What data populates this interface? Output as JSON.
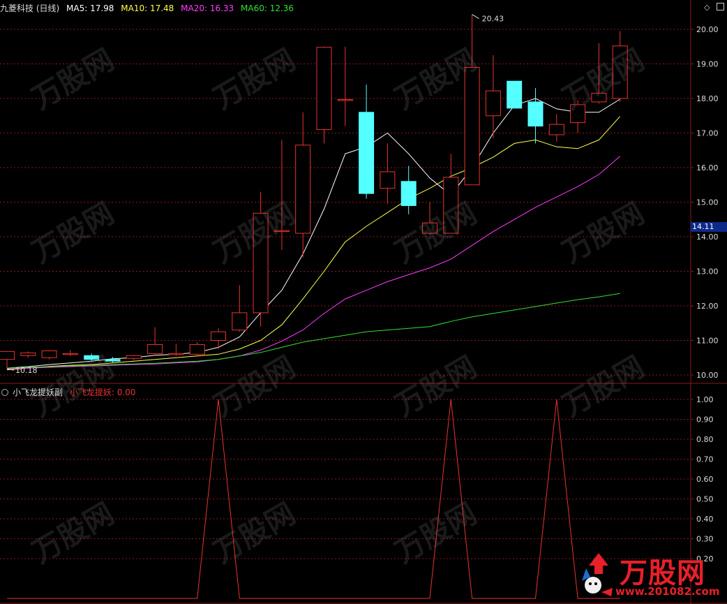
{
  "header": {
    "title": "九菱科技 (日线)",
    "ma5_label": "MA5: 17.98",
    "ma10_label": "MA10: 17.48",
    "ma20_label": "MA20: 16.33",
    "ma60_label": "MA60: 12.36"
  },
  "sub_header": {
    "title": "小飞龙提妖副",
    "value_label": "小飞龙提妖: 0.00"
  },
  "current_price": "14.11",
  "high_marker": "20.43",
  "low_marker": "10.18",
  "logo": {
    "brand": "万股网",
    "url": "www.201082.com"
  },
  "watermark": "万股网",
  "colors": {
    "background": "#000000",
    "up": "#e8342f",
    "down": "#54ffff",
    "ma5": "#ffffff",
    "ma10": "#ffff4d",
    "ma20": "#ff3cff",
    "ma60": "#33e033",
    "grid": "#8b1a1a",
    "axis_text": "#dddddd"
  },
  "chart_data": [
    {
      "type": "candlestick",
      "title": "",
      "ylim": [
        9.9,
        20.5
      ],
      "y_ticks": [
        "10.00",
        "11.00",
        "12.00",
        "13.00",
        "14.00",
        "15.00",
        "16.00",
        "17.00",
        "18.00",
        "19.00",
        "20.00"
      ],
      "y_tick_values": [
        10,
        11,
        12,
        13,
        14,
        15,
        16,
        17,
        18,
        19,
        20
      ],
      "grid": true,
      "candles": [
        {
          "o": 10.45,
          "h": 10.68,
          "l": 10.18,
          "c": 10.68
        },
        {
          "o": 10.56,
          "h": 10.68,
          "l": 10.5,
          "c": 10.64
        },
        {
          "o": 10.5,
          "h": 10.72,
          "l": 10.45,
          "c": 10.7
        },
        {
          "o": 10.6,
          "h": 10.72,
          "l": 10.55,
          "c": 10.62
        },
        {
          "o": 10.56,
          "h": 10.62,
          "l": 10.4,
          "c": 10.45
        },
        {
          "o": 10.45,
          "h": 10.52,
          "l": 10.35,
          "c": 10.4
        },
        {
          "o": 10.48,
          "h": 10.58,
          "l": 10.42,
          "c": 10.56
        },
        {
          "o": 10.62,
          "h": 11.38,
          "l": 10.55,
          "c": 10.88
        },
        {
          "o": 10.6,
          "h": 10.9,
          "l": 10.55,
          "c": 10.62
        },
        {
          "o": 10.6,
          "h": 10.95,
          "l": 10.55,
          "c": 10.88
        },
        {
          "o": 11.0,
          "h": 11.35,
          "l": 10.75,
          "c": 11.25
        },
        {
          "o": 11.3,
          "h": 12.6,
          "l": 11.25,
          "c": 11.8
        },
        {
          "o": 11.8,
          "h": 15.3,
          "l": 11.4,
          "c": 14.68
        },
        {
          "o": 14.18,
          "h": 16.8,
          "l": 13.62,
          "c": 14.18
        },
        {
          "o": 14.1,
          "h": 17.6,
          "l": 13.4,
          "c": 16.65
        },
        {
          "o": 17.1,
          "h": 19.5,
          "l": 16.7,
          "c": 19.48
        },
        {
          "o": 17.97,
          "h": 19.5,
          "l": 17.2,
          "c": 17.97
        },
        {
          "o": 17.6,
          "h": 18.4,
          "l": 15.1,
          "c": 15.25
        },
        {
          "o": 15.4,
          "h": 16.7,
          "l": 14.95,
          "c": 15.88
        },
        {
          "o": 15.6,
          "h": 16.05,
          "l": 14.65,
          "c": 14.9
        },
        {
          "o": 14.1,
          "h": 15.0,
          "l": 14.05,
          "c": 14.4
        },
        {
          "o": 14.1,
          "h": 16.4,
          "l": 14.1,
          "c": 15.72
        },
        {
          "o": 15.5,
          "h": 20.43,
          "l": 15.5,
          "c": 18.9
        },
        {
          "o": 17.5,
          "h": 19.25,
          "l": 16.85,
          "c": 18.22
        },
        {
          "o": 18.5,
          "h": 18.5,
          "l": 17.72,
          "c": 17.72
        },
        {
          "o": 17.9,
          "h": 18.3,
          "l": 16.7,
          "c": 17.2
        },
        {
          "o": 16.95,
          "h": 17.55,
          "l": 16.75,
          "c": 17.25
        },
        {
          "o": 17.3,
          "h": 17.95,
          "l": 17.0,
          "c": 17.82
        },
        {
          "o": 17.9,
          "h": 19.6,
          "l": 17.85,
          "c": 18.15
        },
        {
          "o": 18.0,
          "h": 19.95,
          "l": 17.9,
          "c": 19.52
        }
      ],
      "series": [
        {
          "name": "MA5",
          "values": [
            10.2,
            10.24,
            10.3,
            10.35,
            10.4,
            10.47,
            10.5,
            10.57,
            10.6,
            10.65,
            10.8,
            11.1,
            11.8,
            12.45,
            13.5,
            14.8,
            16.4,
            16.6,
            17.0,
            16.4,
            15.7,
            15.2,
            16.0,
            17.0,
            17.8,
            18.0,
            17.7,
            17.6,
            17.6,
            17.98
          ]
        },
        {
          "name": "MA10",
          "values": [
            10.15,
            10.2,
            10.25,
            10.28,
            10.3,
            10.35,
            10.4,
            10.45,
            10.5,
            10.55,
            10.6,
            10.75,
            11.0,
            11.45,
            12.2,
            13.0,
            13.85,
            14.3,
            14.7,
            15.1,
            15.4,
            15.75,
            16.0,
            16.3,
            16.7,
            16.8,
            16.6,
            16.55,
            16.8,
            17.48
          ]
        },
        {
          "name": "MA20",
          "values": [
            10.18,
            10.2,
            10.22,
            10.24,
            10.26,
            10.28,
            10.3,
            10.32,
            10.35,
            10.38,
            10.45,
            10.55,
            10.72,
            10.98,
            11.3,
            11.78,
            12.2,
            12.45,
            12.7,
            12.9,
            13.1,
            13.35,
            13.75,
            14.15,
            14.5,
            14.85,
            15.15,
            15.45,
            15.8,
            16.33
          ]
        },
        {
          "name": "MA60",
          "values": [
            10.2,
            10.22,
            10.24,
            10.26,
            10.28,
            10.3,
            10.32,
            10.34,
            10.37,
            10.4,
            10.45,
            10.55,
            10.65,
            10.8,
            10.95,
            11.05,
            11.15,
            11.25,
            11.3,
            11.35,
            11.4,
            11.55,
            11.68,
            11.78,
            11.88,
            11.98,
            12.08,
            12.18,
            12.26,
            12.36
          ]
        }
      ]
    },
    {
      "type": "line",
      "title": "",
      "ylim": [
        0,
        1.04
      ],
      "y_ticks": [
        "0.20",
        "0.30",
        "0.40",
        "0.50",
        "0.60",
        "0.70",
        "0.80",
        "0.90",
        "1.00"
      ],
      "y_tick_values": [
        0.2,
        0.3,
        0.4,
        0.5,
        0.6,
        0.7,
        0.8,
        0.9,
        1.0
      ],
      "grid": true,
      "series": [
        {
          "name": "小飞龙提妖",
          "values": [
            0,
            0,
            0,
            0,
            0,
            0,
            0,
            0,
            0,
            0,
            1,
            0,
            0,
            0,
            0,
            0,
            0,
            0,
            0,
            0,
            0,
            1,
            0,
            0,
            0,
            0,
            1,
            0,
            0,
            0
          ]
        }
      ]
    }
  ]
}
